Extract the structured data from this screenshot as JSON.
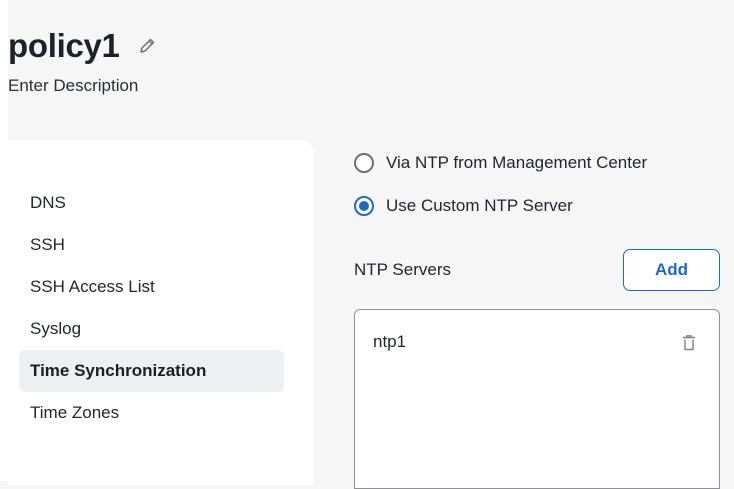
{
  "header": {
    "title": "policy1",
    "description": "Enter Description",
    "edit_icon": "pencil-icon"
  },
  "sidebar": {
    "items": [
      {
        "label": "DNS",
        "active": false
      },
      {
        "label": "SSH",
        "active": false
      },
      {
        "label": "SSH Access List",
        "active": false
      },
      {
        "label": "Syslog",
        "active": false
      },
      {
        "label": "Time Synchronization",
        "active": true
      },
      {
        "label": "Time Zones",
        "active": false
      }
    ]
  },
  "time_sync": {
    "options": [
      {
        "label": "Via NTP from Management Center",
        "selected": false
      },
      {
        "label": "Use Custom NTP Server",
        "selected": true
      }
    ],
    "ntp_servers_label": "NTP Servers",
    "add_label": "Add",
    "servers": [
      {
        "name": "ntp1",
        "delete_icon": "trash-icon"
      }
    ]
  },
  "colors": {
    "accent": "#1d69cc",
    "active_nav_bg": "#eeeff1",
    "page_bg": "#f6f6f7"
  }
}
